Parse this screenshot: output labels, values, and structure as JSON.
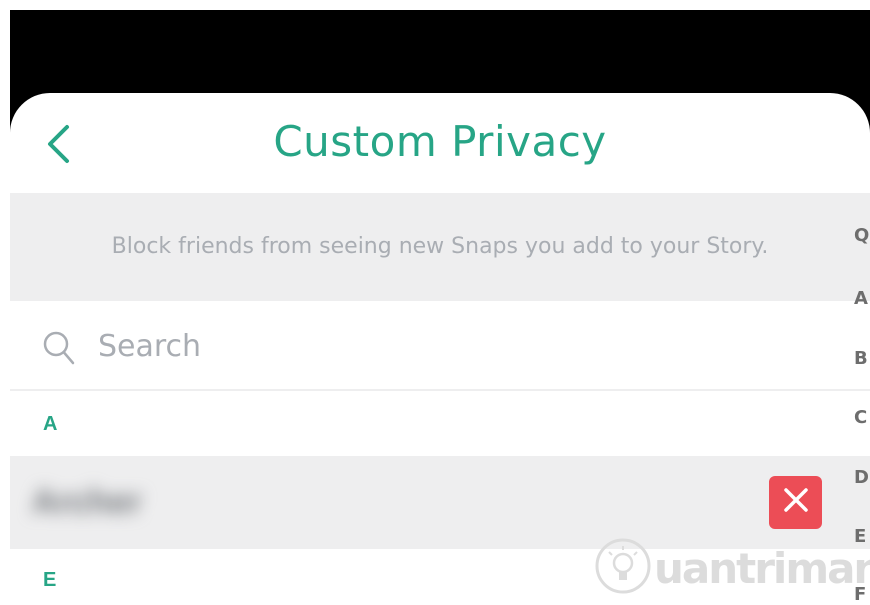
{
  "header": {
    "title": "Custom Privacy",
    "back_icon": "chevron-left-icon"
  },
  "info": {
    "text": "Block friends from seeing new Snaps you add to your Story."
  },
  "search": {
    "placeholder": "Search",
    "value": "",
    "icon": "search-icon"
  },
  "sections": [
    {
      "letter": "A"
    },
    {
      "letter": "E"
    }
  ],
  "friends": [
    {
      "name": "Archer",
      "blurred": true,
      "remove_icon": "close-icon"
    }
  ],
  "index_bar": [
    "Q",
    "A",
    "B",
    "C",
    "D",
    "E",
    "F"
  ],
  "watermark": {
    "text": "uantrimang",
    "icon": "lightbulb-icon"
  },
  "colors": {
    "accent": "#27a586",
    "band_background": "#eeeeef",
    "muted_text": "#a9adb3",
    "remove_red": "#ec4d56"
  }
}
